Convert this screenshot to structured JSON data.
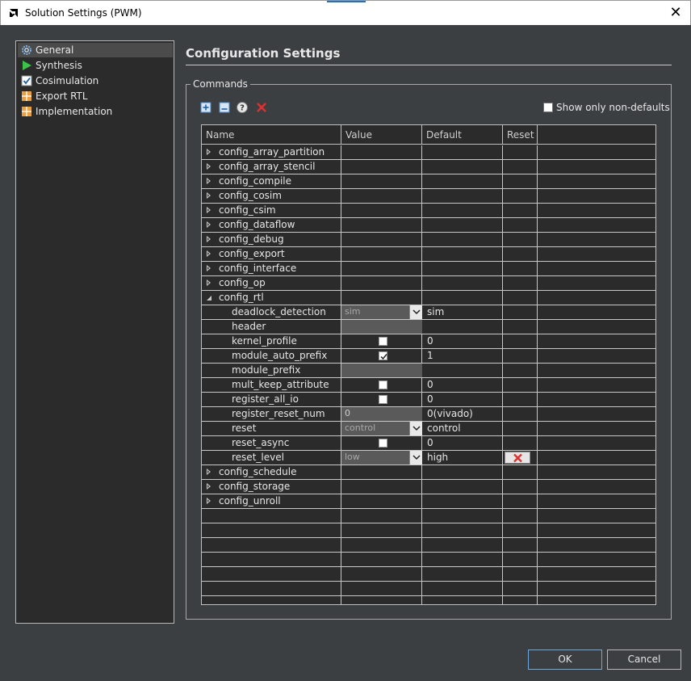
{
  "window": {
    "title": "Solution Settings (PWM)",
    "close_glyph": "✕",
    "app_icon": "amd-logo-icon"
  },
  "nav": {
    "items": [
      {
        "label": "General",
        "icon": "gear-icon",
        "selected": true
      },
      {
        "label": "Synthesis",
        "icon": "play-icon"
      },
      {
        "label": "Cosimulation",
        "icon": "checkbox-icon"
      },
      {
        "label": "Export RTL",
        "icon": "grid-icon"
      },
      {
        "label": "Implementation",
        "icon": "grid-icon"
      }
    ]
  },
  "page": {
    "title": "Configuration Settings"
  },
  "commands": {
    "group_label": "Commands",
    "toolbar": {
      "add": "add-command-icon",
      "remove": "remove-command-icon",
      "help": "help-icon",
      "delete": "delete-icon"
    },
    "show_non_defaults_label": "Show only non-defaults",
    "show_non_defaults_checked": false
  },
  "table": {
    "columns": {
      "name": "Name",
      "value": "Value",
      "default": "Default",
      "reset": "Reset"
    },
    "rows": [
      {
        "name": "config_array_partition",
        "level": 0,
        "expander": "closed"
      },
      {
        "name": "config_array_stencil",
        "level": 0,
        "expander": "closed"
      },
      {
        "name": "config_compile",
        "level": 0,
        "expander": "closed"
      },
      {
        "name": "config_cosim",
        "level": 0,
        "expander": "closed"
      },
      {
        "name": "config_csim",
        "level": 0,
        "expander": "closed"
      },
      {
        "name": "config_dataflow",
        "level": 0,
        "expander": "closed"
      },
      {
        "name": "config_debug",
        "level": 0,
        "expander": "closed"
      },
      {
        "name": "config_export",
        "level": 0,
        "expander": "closed"
      },
      {
        "name": "config_interface",
        "level": 0,
        "expander": "closed"
      },
      {
        "name": "config_op",
        "level": 0,
        "expander": "closed"
      },
      {
        "name": "config_rtl",
        "level": 0,
        "expander": "open"
      },
      {
        "name": "deadlock_detection",
        "level": 1,
        "editor": "combo",
        "value": "sim",
        "default": "sim"
      },
      {
        "name": "header",
        "level": 1,
        "editor": "field",
        "value": "",
        "default": ""
      },
      {
        "name": "kernel_profile",
        "level": 1,
        "editor": "checkbox",
        "checked": false,
        "default": "0"
      },
      {
        "name": "module_auto_prefix",
        "level": 1,
        "editor": "checkbox",
        "checked": true,
        "default": "1"
      },
      {
        "name": "module_prefix",
        "level": 1,
        "editor": "field",
        "value": "",
        "default": ""
      },
      {
        "name": "mult_keep_attribute",
        "level": 1,
        "editor": "checkbox",
        "checked": false,
        "default": "0"
      },
      {
        "name": "register_all_io",
        "level": 1,
        "editor": "checkbox",
        "checked": false,
        "default": "0"
      },
      {
        "name": "register_reset_num",
        "level": 1,
        "editor": "field",
        "value": "0",
        "default": "0(vivado)"
      },
      {
        "name": "reset",
        "level": 1,
        "editor": "combo",
        "value": "control",
        "default": "control"
      },
      {
        "name": "reset_async",
        "level": 1,
        "editor": "checkbox",
        "checked": false,
        "default": "0"
      },
      {
        "name": "reset_level",
        "level": 1,
        "editor": "combo",
        "value": "low",
        "default": "high",
        "reset_button": true
      },
      {
        "name": "config_schedule",
        "level": 0,
        "expander": "closed"
      },
      {
        "name": "config_storage",
        "level": 0,
        "expander": "closed"
      },
      {
        "name": "config_unroll",
        "level": 0,
        "expander": "closed"
      }
    ],
    "empty_rows": 7
  },
  "buttons": {
    "ok": "OK",
    "cancel": "Cancel"
  },
  "colors": {
    "background": "#3c3f41",
    "panel": "#2b2b2b",
    "delete_red": "#e03030",
    "accent_blue": "#1e73c8"
  }
}
